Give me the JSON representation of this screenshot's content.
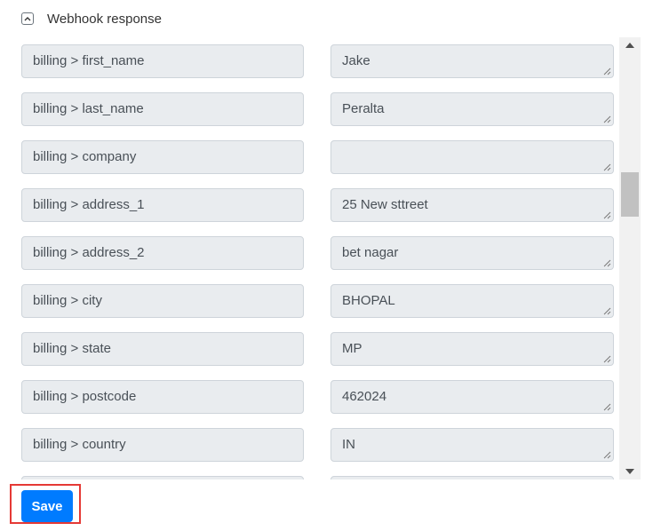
{
  "section": {
    "title": "Webhook response",
    "toggle_icon": "chevron-up-icon",
    "expanded": true
  },
  "fields": [
    {
      "key": "billing > first_name",
      "value": "Jake"
    },
    {
      "key": "billing > last_name",
      "value": "Peralta"
    },
    {
      "key": "billing > company",
      "value": ""
    },
    {
      "key": "billing > address_1",
      "value": "25 New sttreet"
    },
    {
      "key": "billing > address_2",
      "value": "bet nagar"
    },
    {
      "key": "billing > city",
      "value": "BHOPAL"
    },
    {
      "key": "billing > state",
      "value": "MP"
    },
    {
      "key": "billing > postcode",
      "value": "462024"
    },
    {
      "key": "billing > country",
      "value": "IN"
    },
    {
      "key": "",
      "value": ""
    }
  ],
  "save_button": {
    "label": "Save",
    "color": "#007bff",
    "highlight_color": "#e53935"
  },
  "scrollbar": {
    "icons": [
      "arrow-up-icon",
      "arrow-down-icon"
    ]
  }
}
